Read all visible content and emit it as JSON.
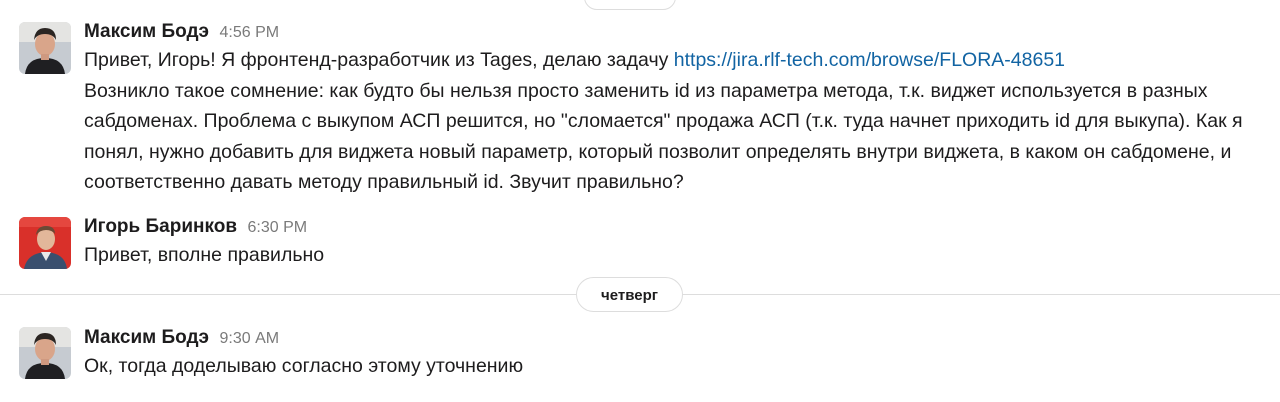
{
  "messages": [
    {
      "sender": "Максим Бодэ",
      "time": "4:56 PM",
      "avatar_icon": "user-photo-man-dark-hair",
      "text_before_link": "Привет, Игорь! Я фронтенд-разработчик из Tages, делаю задачу ",
      "link": "https://jira.rlf-tech.com/browse/FLORA-48651",
      "text_after_link": "Возникло такое сомнение: как будто бы нельзя просто заменить id из параметра метода, т.к. виджет используется в разных сабдоменах. Проблема с выкупом АСП решится, но \"сломается\" продажа АСП (т.к. туда начнет приходить id для выкупа). Как я понял, нужно добавить для виджета новый параметр, который позволит определять внутри виджета, в каком он сабдомене, и соответственно давать методу правильный id. Звучит правильно?"
    },
    {
      "sender": "Игорь Баринков",
      "time": "6:30 PM",
      "avatar_icon": "user-photo-man-red-background",
      "text": "Привет, вполне правильно"
    },
    {
      "sender": "Максим Бодэ",
      "time": "9:30 AM",
      "avatar_icon": "user-photo-man-dark-hair",
      "text": "Ок, тогда доделываю согласно этому уточнению"
    }
  ],
  "day_divider": "четверг",
  "colors": {
    "link": "#1264a3",
    "text": "#1d1c1d",
    "timestamp": "#7a7a7a",
    "divider": "#dddddd",
    "avatar2_bg": "#d9302a"
  }
}
